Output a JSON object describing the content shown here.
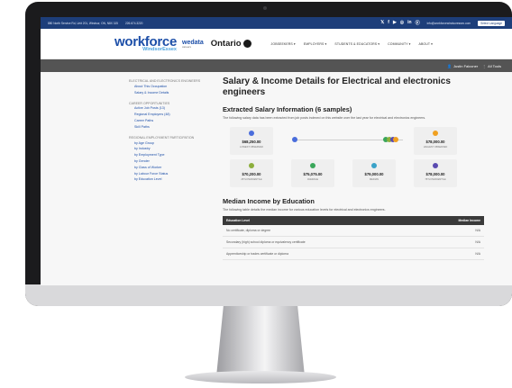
{
  "topbar": {
    "address": "880 North Service Rd, Unit 201, Windsor, ON, N8X 3J5",
    "phone": "226.674.3220",
    "email": "info@workforcewindsoressex.com",
    "language": "Select Language"
  },
  "header": {
    "logo_main": "workforce",
    "logo_sub": "WindsorEssex",
    "wedata": "wedata",
    "wedata_sub": "careers",
    "ontario": "Ontario",
    "nav": [
      "JOBSEEKERS ▾",
      "EMPLOYERS ▾",
      "STUDENTS & EDUCATORS ▾",
      "COMMUNITY ▾",
      "ABOUT ▾"
    ]
  },
  "userbar": {
    "user": "Justin Falconer",
    "tools": "All Tools"
  },
  "sidebar": {
    "sections": [
      {
        "title": "ELECTRICAL AND ELECTRONICS ENGINEERS",
        "links": [
          "About This Occupation",
          "Salary & Income Details"
        ]
      },
      {
        "title": "CAREER OPPORTUNITIES",
        "links": [
          "Active Job Posts (13)",
          "Regional Employers (48)",
          "Career Paths",
          "Skill Paths"
        ]
      },
      {
        "title": "REGIONAL EMPLOYMENT PARTICIPATION",
        "links": [
          "by Age Group",
          "by Industry",
          "by Employment Type",
          "by Gender",
          "by Class of Worker",
          "by Labour Force Status",
          "by Education Level"
        ]
      }
    ]
  },
  "main": {
    "title": "Salary & Income Details for Electrical and electronics engineers",
    "salary_heading": "Extracted Salary Information (6 samples)",
    "salary_desc": "The following salary data has been extracted from job posts indexed on this website over the last year for electrical and electronics engineers.",
    "salary_cards": [
      {
        "value": "$68,250.00",
        "label": "LOWEST OBSERVED",
        "color": "#4a6ddc"
      },
      {
        "value": "$78,000.00",
        "label": "HIGHEST OBSERVED",
        "color": "#f0a020"
      },
      {
        "value": "$70,200.00",
        "label": "25TH PERCENTILE",
        "color": "#8cae3c"
      },
      {
        "value": "$75,075.00",
        "label": "AVERAGE",
        "color": "#3aa65a"
      },
      {
        "value": "$79,000.00",
        "label": "MEDIAN",
        "color": "#3aa2c8"
      },
      {
        "value": "$78,000.00",
        "label": "75TH PERCENTILE",
        "color": "#5a4ab0"
      }
    ],
    "income_heading": "Median Income by Education",
    "income_desc": "The following table details the median income for various education levels for electrical and electronics engineers.",
    "table": {
      "headers": [
        "Education Level",
        "Median Income"
      ],
      "rows": [
        [
          "No certificate, diploma or degree",
          "N/A"
        ],
        [
          "Secondary (high) school diploma or equivalency certificate",
          "N/A"
        ],
        [
          "Apprenticeship or trades certificate or diploma",
          "N/A"
        ]
      ]
    }
  }
}
